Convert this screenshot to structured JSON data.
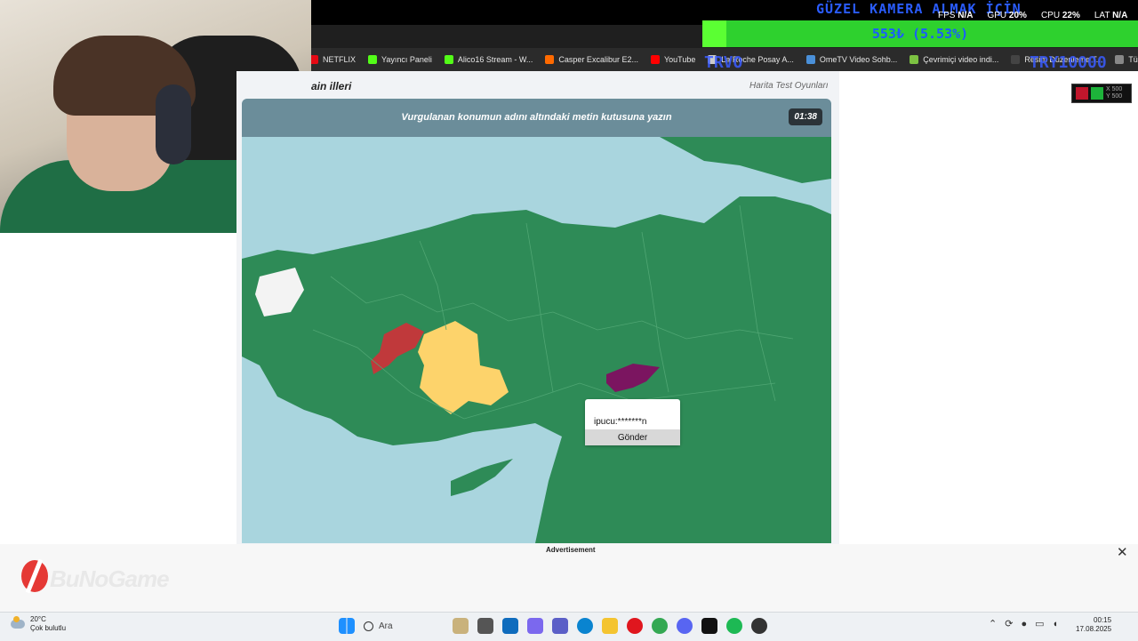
{
  "overlay": {
    "title": "GÜZEL KAMERA ALMAK İÇİN",
    "donation_text": "553₺ (5.53%)",
    "donation_progress": 0.0553,
    "fps_label": "FPS",
    "fps_value": "N/A",
    "gpu_label": "GPU",
    "gpu_value": "20%",
    "cpu_label": "CPU",
    "cpu_value": "22%",
    "lat_label": "LAT",
    "lat_value": "N/A",
    "trvo_left": "TRVO",
    "trvo_right": "TRY10000"
  },
  "bookmarks": [
    {
      "label": "NETFLIX",
      "color": "#e50914"
    },
    {
      "label": "Yayıncı Paneli",
      "color": "#53fc18"
    },
    {
      "label": "Alico16 Stream - W...",
      "color": "#53fc18"
    },
    {
      "label": "Casper Excalibur E2...",
      "color": "#ff6a00"
    },
    {
      "label": "YouTube",
      "color": "#ff0000"
    },
    {
      "label": "La Roche Posay A...",
      "color": "#cccccc"
    },
    {
      "label": "OmeTV Video Sohb...",
      "color": "#4a90d9"
    },
    {
      "label": "Çevrimiçi video indi...",
      "color": "#7cc242"
    },
    {
      "label": "Resim Düzenleme T...",
      "color": "#444444"
    },
    {
      "label": "Tüm yer işaretleri",
      "color": "#888888"
    }
  ],
  "page": {
    "title": "ain illeri",
    "subtitle": "Harita Test Oyunları"
  },
  "extension": {
    "x": "X 500",
    "y": "Y 500"
  },
  "quiz": {
    "instruction": "Vurgulanan konumun adını altındaki metin kutusuna yazın",
    "timer": "01:38",
    "hint": "ipucu:*******n",
    "submit_label": "Gönder"
  },
  "colors": {
    "land": "#2e8b57",
    "sea": "#a9d5de",
    "highlight_red": "#c0393b",
    "highlight_yellow": "#fdd36b",
    "highlight_purple": "#7b1560",
    "banner": "#5a7887"
  },
  "ad": {
    "label": "Advertisement",
    "logo_text": "BuNoGame",
    "close": "✕"
  },
  "taskbar": {
    "temperature": "20°C",
    "weather": "Çok bulutlu",
    "search_label": "Ara",
    "time": "00:15",
    "date": "17.08.2025"
  }
}
